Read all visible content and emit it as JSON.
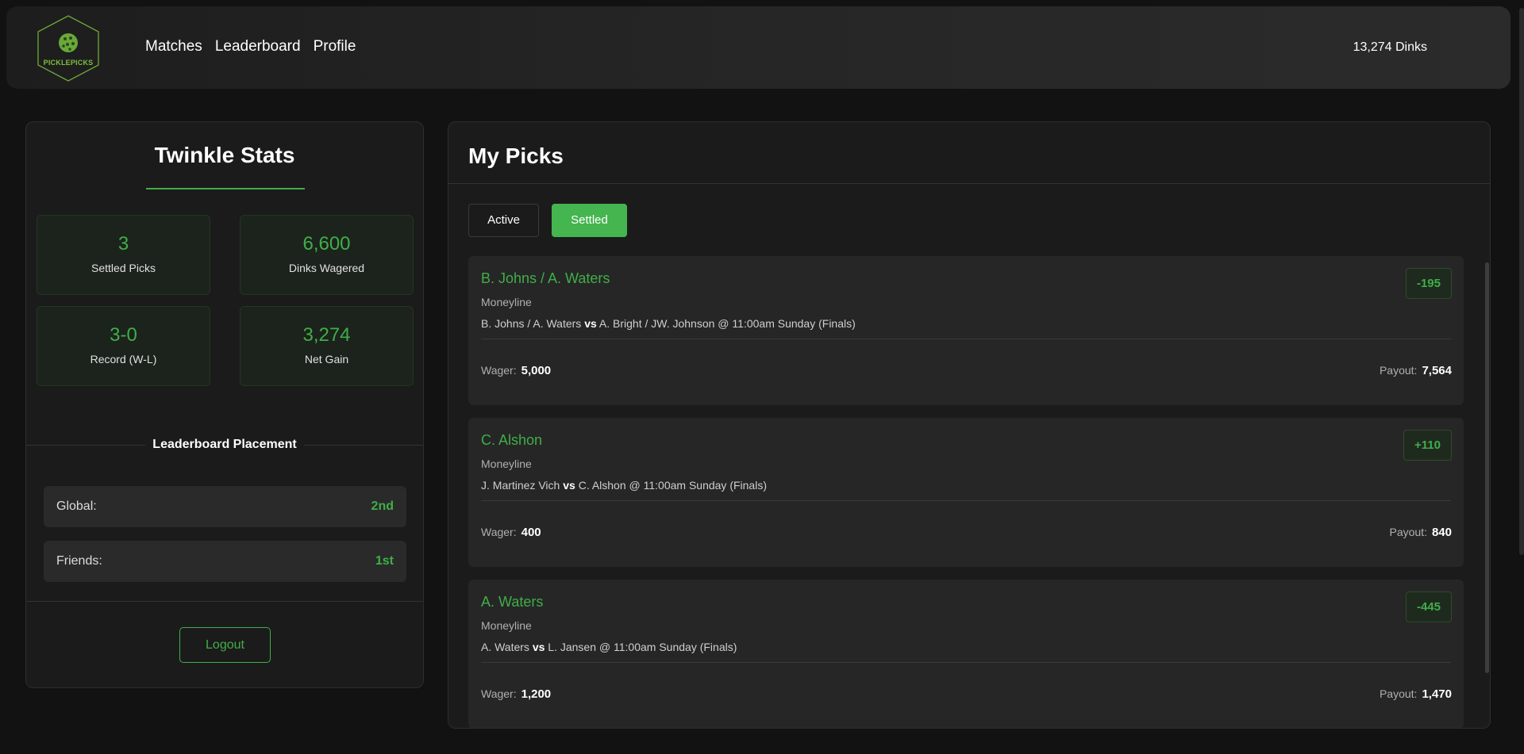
{
  "header": {
    "logo_text": "PICKLEPICKS",
    "nav": [
      "Matches",
      "Leaderboard",
      "Profile"
    ],
    "balance": "13,274 Dinks"
  },
  "stats": {
    "title": "Twinkle Stats",
    "boxes": [
      {
        "value": "3",
        "label": "Settled Picks"
      },
      {
        "value": "6,600",
        "label": "Dinks Wagered"
      },
      {
        "value": "3-0",
        "label": "Record (W-L)"
      },
      {
        "value": "3,274",
        "label": "Net Gain"
      }
    ],
    "leaderboard_title": "Leaderboard Placement",
    "placements": [
      {
        "key": "Global:",
        "value": "2nd"
      },
      {
        "key": "Friends:",
        "value": "1st"
      }
    ],
    "logout": "Logout"
  },
  "picks": {
    "title": "My Picks",
    "tabs": {
      "active": "Active",
      "settled": "Settled"
    },
    "vs": "vs",
    "wager_label": "Wager:",
    "payout_label": "Payout:",
    "items": [
      {
        "name": "B. Johns / A. Waters",
        "type": "Moneyline",
        "team1": "B. Johns / A. Waters",
        "team2": "A. Bright / JW. Johnson @ 11:00am Sunday (Finals)",
        "odds": "-195",
        "wager": "5,000",
        "payout": "7,564"
      },
      {
        "name": "C. Alshon",
        "type": "Moneyline",
        "team1": "J. Martinez Vich",
        "team2": "C. Alshon @ 11:00am Sunday (Finals)",
        "odds": "+110",
        "wager": "400",
        "payout": "840"
      },
      {
        "name": "A. Waters",
        "type": "Moneyline",
        "team1": "A. Waters",
        "team2": "L. Jansen @ 11:00am Sunday (Finals)",
        "odds": "-445",
        "wager": "1,200",
        "payout": "1,470"
      }
    ]
  },
  "colors": {
    "accent": "#3fae49",
    "background": "#121212",
    "panel": "#1b1b1b"
  }
}
